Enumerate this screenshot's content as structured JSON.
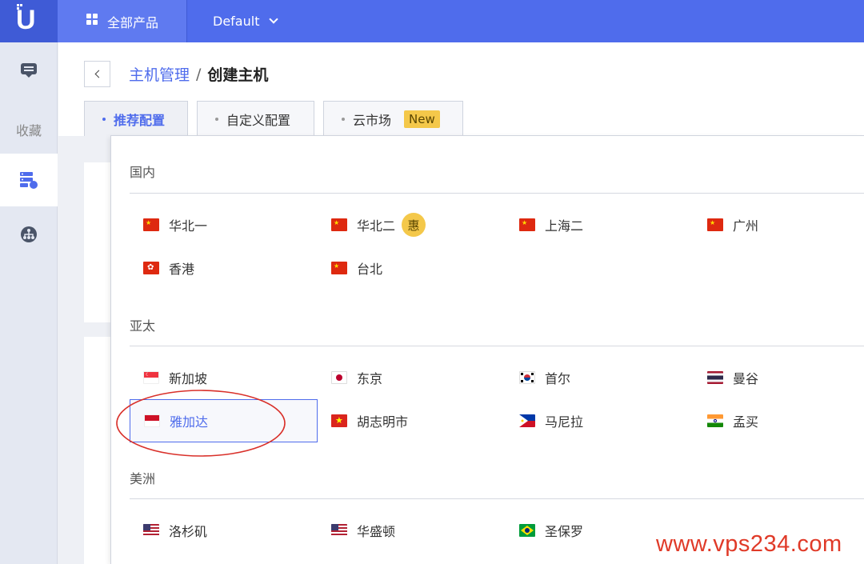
{
  "topbar": {
    "logo_letter": "U",
    "products_label": "全部产品",
    "project_label": "Default"
  },
  "sidebar": {
    "items": [
      {
        "icon": "message-icon"
      },
      {
        "label": "收藏"
      },
      {
        "icon": "host-icon",
        "active": true
      },
      {
        "icon": "network-icon"
      }
    ]
  },
  "breadcrumb": {
    "parent": "主机管理",
    "separator": "/",
    "current": "创建主机"
  },
  "tabs": [
    {
      "label": "推荐配置",
      "active": true
    },
    {
      "label": "自定义配置"
    },
    {
      "label": "云市场",
      "badge": "New"
    }
  ],
  "region_panel": {
    "groups": [
      {
        "title": "国内",
        "regions": [
          {
            "name": "华北一",
            "flag": "cn"
          },
          {
            "name": "华北二",
            "flag": "cn",
            "badge": "惠"
          },
          {
            "name": "上海二",
            "flag": "cn"
          },
          {
            "name": "广州",
            "flag": "cn"
          },
          {
            "name": "香港",
            "flag": "hk"
          },
          {
            "name": "台北",
            "flag": "cn"
          }
        ]
      },
      {
        "title": "亚太",
        "regions": [
          {
            "name": "新加坡",
            "flag": "sg"
          },
          {
            "name": "东京",
            "flag": "jp"
          },
          {
            "name": "首尔",
            "flag": "kr"
          },
          {
            "name": "曼谷",
            "flag": "th"
          },
          {
            "name": "雅加达",
            "flag": "id",
            "selected": true
          },
          {
            "name": "胡志明市",
            "flag": "vn"
          },
          {
            "name": "马尼拉",
            "flag": "ph"
          },
          {
            "name": "孟买",
            "flag": "in"
          }
        ]
      },
      {
        "title": "美洲",
        "regions": [
          {
            "name": "洛杉矶",
            "flag": "us"
          },
          {
            "name": "华盛顿",
            "flag": "us"
          },
          {
            "name": "圣保罗",
            "flag": "br"
          }
        ]
      }
    ]
  },
  "watermark": "www.vps234.com",
  "colors": {
    "primary": "#4f6cec",
    "badge": "#f4c84a",
    "annotation": "#d9302a"
  }
}
